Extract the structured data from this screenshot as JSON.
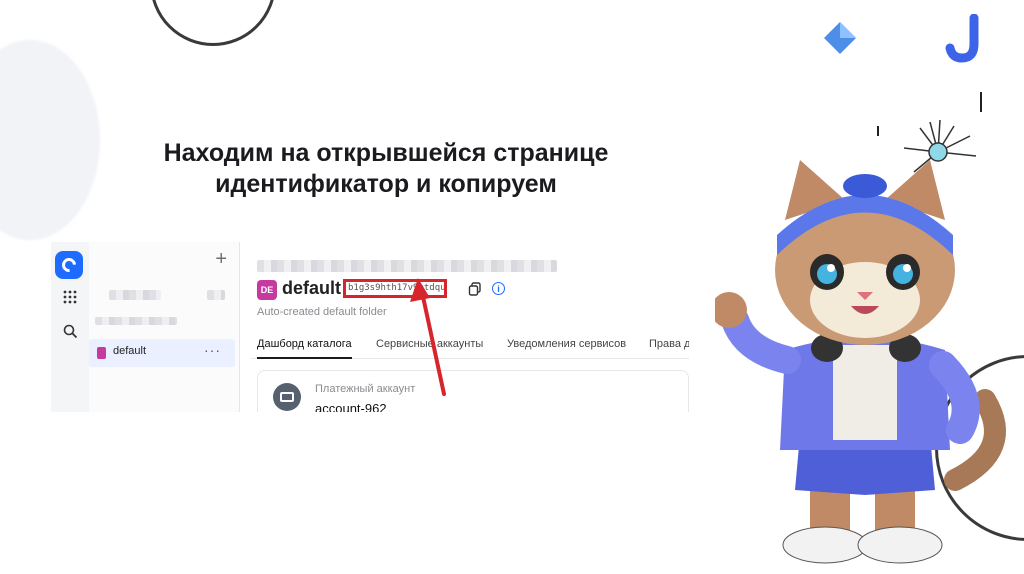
{
  "slide": {
    "headline": [
      "Находим на открывшейся странице",
      "идентификатор и копируем"
    ]
  },
  "console": {
    "nav": {
      "selected_folder": "default"
    },
    "folder": {
      "badge": "DE",
      "title": "default",
      "id": "b1g3s9hth17v9ptdqu",
      "description": "Auto-created default folder"
    },
    "tabs": [
      {
        "label": "Дашборд каталога",
        "active": true
      },
      {
        "label": "Сервисные аккаунты",
        "active": false
      },
      {
        "label": "Уведомления сервисов",
        "active": false
      },
      {
        "label": "Права д",
        "active": false
      }
    ],
    "billing_card": {
      "label": "Платежный аккаунт",
      "value": "account-962"
    }
  },
  "colors": {
    "highlight": "#d7252c",
    "folder_badge": "#c53aa1",
    "accent": "#1e6bff"
  },
  "icons": [
    "add-icon",
    "apps-grid-icon",
    "search-icon",
    "more-icon",
    "copy-icon",
    "info-icon",
    "billing-icon",
    "red-arrow-icon"
  ]
}
